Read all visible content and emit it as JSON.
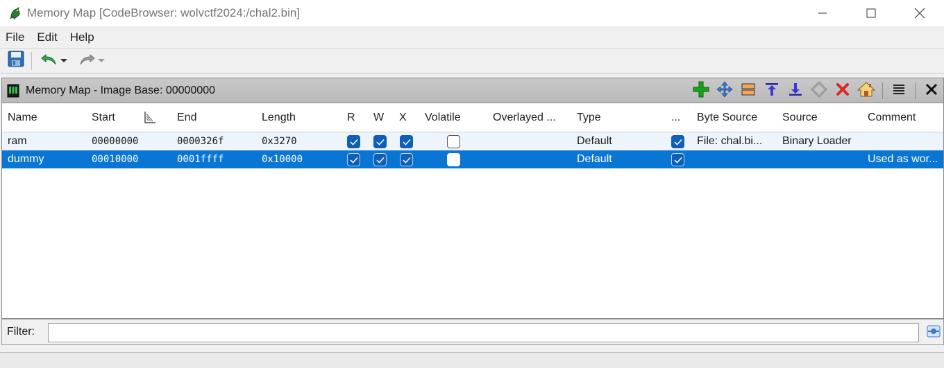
{
  "window": {
    "title": "Memory Map [CodeBrowser: wolvctf2024:/chal2.bin]",
    "icon": "ghidra-dragon-icon"
  },
  "menu": [
    "File",
    "Edit",
    "Help"
  ],
  "toolbar": {
    "icons": [
      "save-icon",
      "undo-icon",
      "redo-icon"
    ]
  },
  "panel": {
    "title": "Memory Map - Image Base: 00000000",
    "actions": [
      "add-block-icon",
      "move-block-icon",
      "split-block-icon",
      "expand-up-icon",
      "expand-down-icon",
      "merge-blocks-icon",
      "delete-block-icon",
      "set-image-base-icon",
      "column-menu-icon",
      "close-icon"
    ]
  },
  "table": {
    "columns": {
      "name": "Name",
      "start": "Start",
      "end": "End",
      "length": "Length",
      "r": "R",
      "w": "W",
      "x": "X",
      "volatile": "Volatile",
      "overlayed": "Overlayed ...",
      "type": "Type",
      "initialized": "...",
      "byte_source": "Byte Source",
      "source": "Source",
      "comment": "Comment"
    },
    "rows": [
      {
        "name": "ram",
        "start": "00000000",
        "end": "0000326f",
        "length": "0x3270",
        "r": true,
        "w": true,
        "x": true,
        "volatile": false,
        "overlayed": "",
        "type": "Default",
        "initialized": true,
        "byte_source": "File: chal.bi...",
        "source": "Binary Loader",
        "comment": ""
      },
      {
        "name": "dummy",
        "start": "00010000",
        "end": "0001ffff",
        "length": "0x10000",
        "r": true,
        "w": true,
        "x": true,
        "volatile": false,
        "overlayed": "",
        "type": "Default",
        "initialized": true,
        "byte_source": "",
        "source": "",
        "comment": "Used as wor..."
      }
    ]
  },
  "filter": {
    "label": "Filter:",
    "value": "",
    "placeholder": ""
  },
  "colors": {
    "selection": "#0a76d3",
    "checkbox": "#0f5fb8"
  }
}
